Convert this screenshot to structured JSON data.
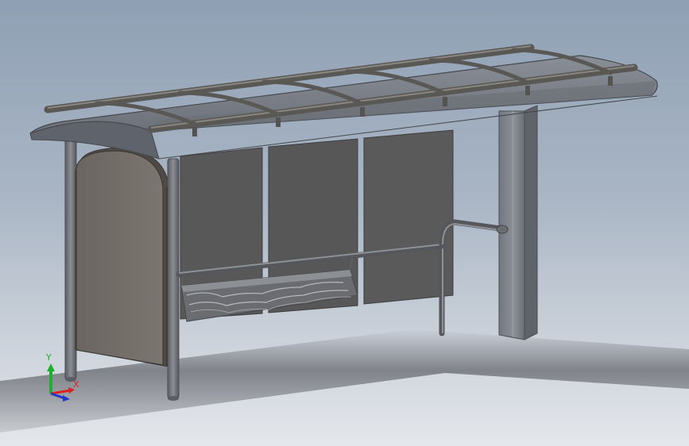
{
  "triad": {
    "x_label": "X",
    "y_label": "Y",
    "z_label": "",
    "colors": {
      "x": "#d92323",
      "y": "#1fae2f",
      "z": "#2238c9"
    }
  },
  "colors": {
    "background_top": "#8fa0b4",
    "background_bottom": "#e4e7eb",
    "metal": "#6d6d6d",
    "panel": "#565656",
    "roof": "#7c7f86"
  }
}
